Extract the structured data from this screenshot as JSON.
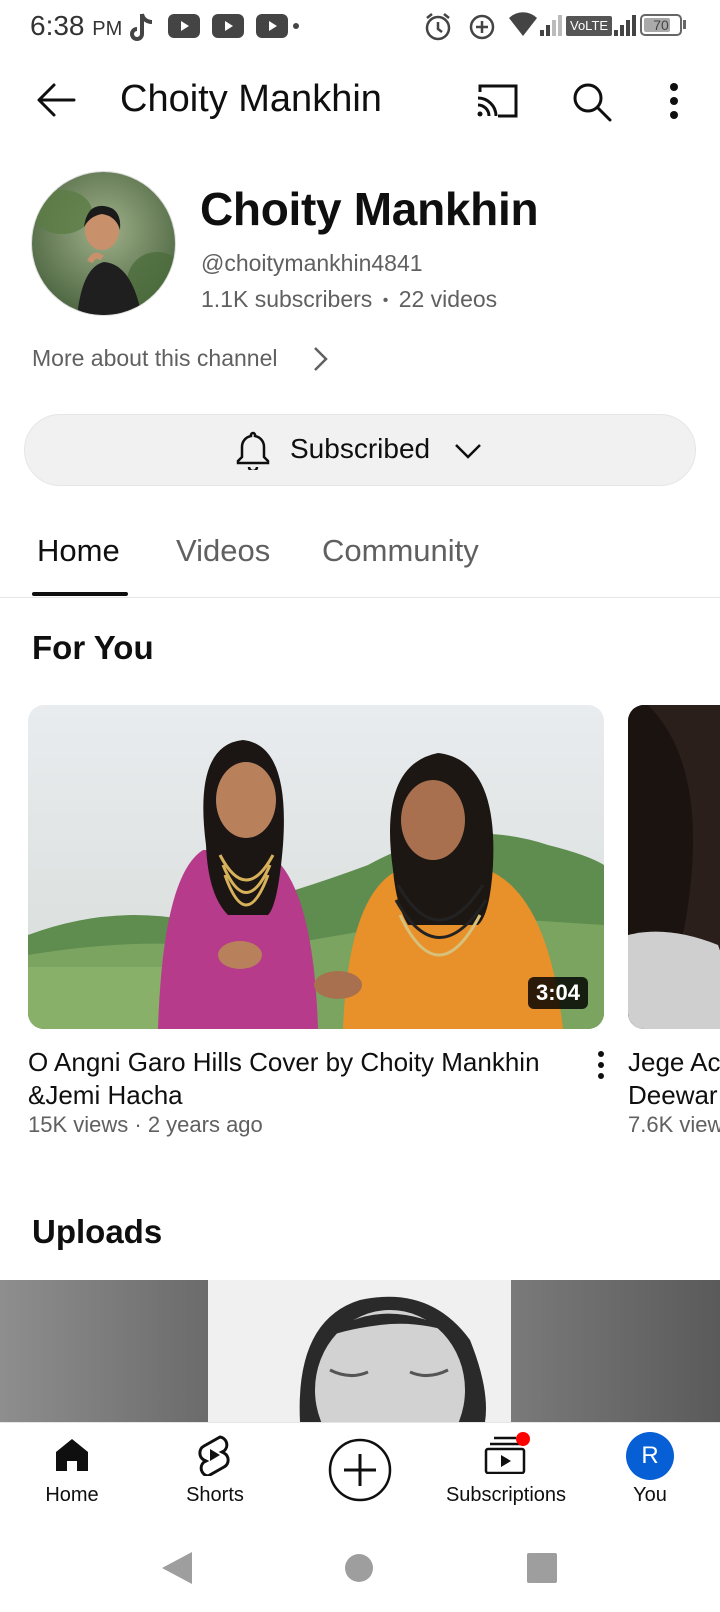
{
  "status_bar": {
    "time": "6:38",
    "ampm": "PM",
    "network_label": "VoLTE",
    "battery": "70"
  },
  "app_bar": {
    "title": "Choity Mankhin",
    "icons": [
      "back-arrow-icon",
      "cast-icon",
      "search-icon",
      "more-vert-icon"
    ]
  },
  "channel": {
    "name": "Choity Mankhin",
    "handle": "@choitymankhin4841",
    "subscribers": "1.1K subscribers",
    "separator": "•",
    "videos": "22 videos",
    "more_about": "More about this channel",
    "subscribe_label": "Subscribed"
  },
  "tabs": [
    {
      "label": "Home",
      "active": true
    },
    {
      "label": "Videos",
      "active": false
    },
    {
      "label": "Community",
      "active": false
    }
  ],
  "for_you": {
    "title": "For You",
    "videos": [
      {
        "title": "O Angni Garo Hills Cover by Choity Mankhin &Jemi Hacha",
        "meta": "15K views · 2 years ago",
        "duration": "3:04"
      },
      {
        "title_line1": "Jege Ac",
        "title_line2": "Deewar",
        "meta": "7.6K view"
      }
    ]
  },
  "uploads": {
    "title": "Uploads"
  },
  "bottom_nav": [
    {
      "label": "Home",
      "icon": "home-icon"
    },
    {
      "label": "Shorts",
      "icon": "shorts-icon"
    },
    {
      "label": "",
      "icon": "create-icon"
    },
    {
      "label": "Subscriptions",
      "icon": "subscriptions-icon"
    },
    {
      "label": "You",
      "icon": "avatar",
      "avatar_letter": "R"
    }
  ],
  "colors": {
    "accent_avatar": "#065fd4",
    "notification_dot": "#ff0000",
    "text_primary": "#0f0f0f",
    "text_secondary": "#606060"
  }
}
